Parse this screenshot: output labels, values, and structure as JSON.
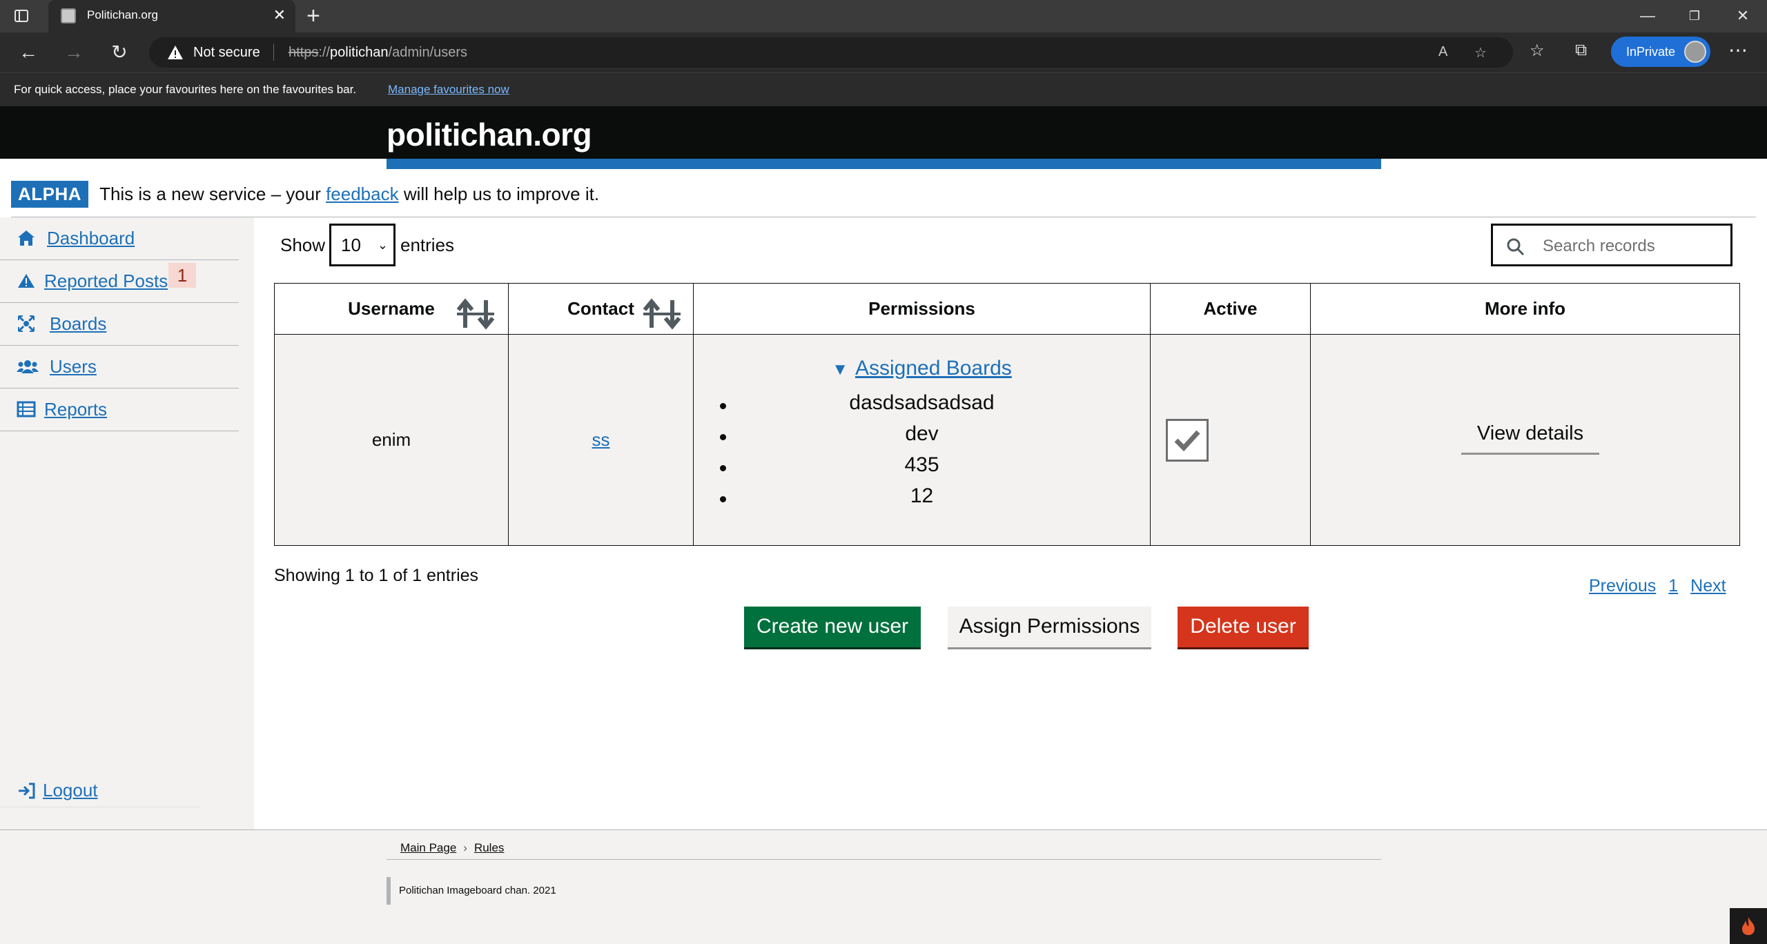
{
  "browser": {
    "tab_title": "Politichan.org",
    "security_label": "Not secure",
    "url_protocol": "https",
    "url_host": "politichan",
    "url_path": "/admin/users",
    "profile_label": "InPrivate",
    "favourites_hint": "For quick access, place your favourites here on the favourites bar.",
    "favourites_link": "Manage favourites now"
  },
  "site": {
    "title": "politichan.org",
    "phase_tag": "ALPHA",
    "phase_text_before": "This is a new service – your ",
    "phase_link": "feedback",
    "phase_text_after": " will help us to improve it."
  },
  "sidebar": {
    "items": [
      {
        "label": "Dashboard",
        "icon": "home-icon"
      },
      {
        "label": "Reported Posts",
        "icon": "warning-icon",
        "badge": "1"
      },
      {
        "label": "Boards",
        "icon": "boards-icon"
      },
      {
        "label": "Users",
        "icon": "users-icon"
      },
      {
        "label": "Reports",
        "icon": "table-icon"
      }
    ],
    "logout_label": "Logout"
  },
  "controls": {
    "show_label": "Show",
    "entries_value": "10",
    "entries_label": "entries",
    "search_placeholder": "Search records"
  },
  "table": {
    "headers": [
      "Username",
      "Contact",
      "Permissions",
      "Active",
      "More info"
    ],
    "rows": [
      {
        "username": "enim",
        "contact": "ss",
        "permissions_summary": "Assigned Boards",
        "boards": [
          "dasdsadsadsad",
          "dev",
          "435",
          "12"
        ],
        "active": true,
        "action": "View details"
      }
    ]
  },
  "pagination": {
    "info": "Showing 1 to 1 of 1 entries",
    "previous": "Previous",
    "page": "1",
    "next": "Next"
  },
  "actions": {
    "create": "Create new user",
    "assign": "Assign Permissions",
    "delete": "Delete user"
  },
  "colors": {
    "brand_blue": "#1d70b8",
    "create_green": "#00703c",
    "delete_red": "#d4351c"
  },
  "footer": {
    "links": [
      "Main Page",
      "Rules"
    ],
    "copyright": "Politichan Imageboard chan. 2021"
  }
}
